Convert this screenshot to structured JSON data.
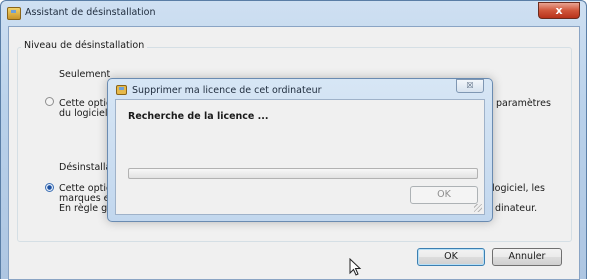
{
  "main_window": {
    "title": "Assistant de désinstallation",
    "close_glyph": "x",
    "group_title": "Niveau de désinstallation",
    "option1": {
      "label": "Seulement",
      "desc_line1": "Cette optio",
      "desc_line1_right": "paramètres",
      "desc_line2": "du logiciel,",
      "checked": false
    },
    "option2": {
      "label": "Désinstalla",
      "desc_line1": "Cette optio",
      "desc_line1_right": "logiciel, les",
      "desc_line2": "marques et",
      "desc_line3": "En règle gé",
      "desc_line3_right": "dinateur.",
      "checked": true
    },
    "ok_label": "OK",
    "cancel_label": "Annuler"
  },
  "dialog": {
    "title": "Supprimer ma licence de cet ordinateur",
    "close_glyph": "☒",
    "heading": "Recherche de la licence ...",
    "progress_fraction": 0,
    "ok_label": "OK"
  },
  "colors": {
    "accent": "#3c7fb1",
    "close_red": "#d0563a"
  }
}
